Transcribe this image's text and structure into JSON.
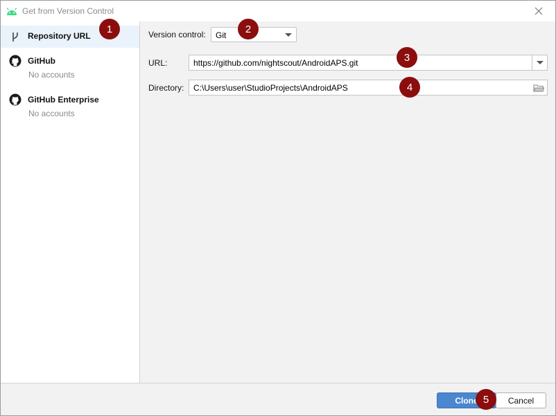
{
  "window": {
    "title": "Get from Version Control",
    "title_icon": "android-icon",
    "close_icon": "close-icon"
  },
  "sidebar": {
    "items": [
      {
        "label": "Repository URL",
        "sub": "",
        "icon": "branch-icon",
        "selected": true
      },
      {
        "label": "GitHub",
        "sub": "No accounts",
        "icon": "github-icon",
        "selected": false
      },
      {
        "label": "GitHub Enterprise",
        "sub": "No accounts",
        "icon": "github-icon",
        "selected": false
      }
    ]
  },
  "form": {
    "vcs_label": "Version control:",
    "vcs_value": "Git",
    "url_label": "URL:",
    "url_value": "https://github.com/nightscout/AndroidAPS.git",
    "dir_label": "Directory:",
    "dir_value": "C:\\Users\\user\\StudioProjects\\AndroidAPS"
  },
  "footer": {
    "clone_label": "Clone",
    "cancel_label": "Cancel"
  },
  "annotations": [
    "1",
    "2",
    "3",
    "4",
    "5"
  ],
  "colors": {
    "accent": "#4a87cf",
    "selected_bg": "#eaf3fc",
    "badge": "#8b0d0d",
    "android_green": "#3ddc84"
  }
}
